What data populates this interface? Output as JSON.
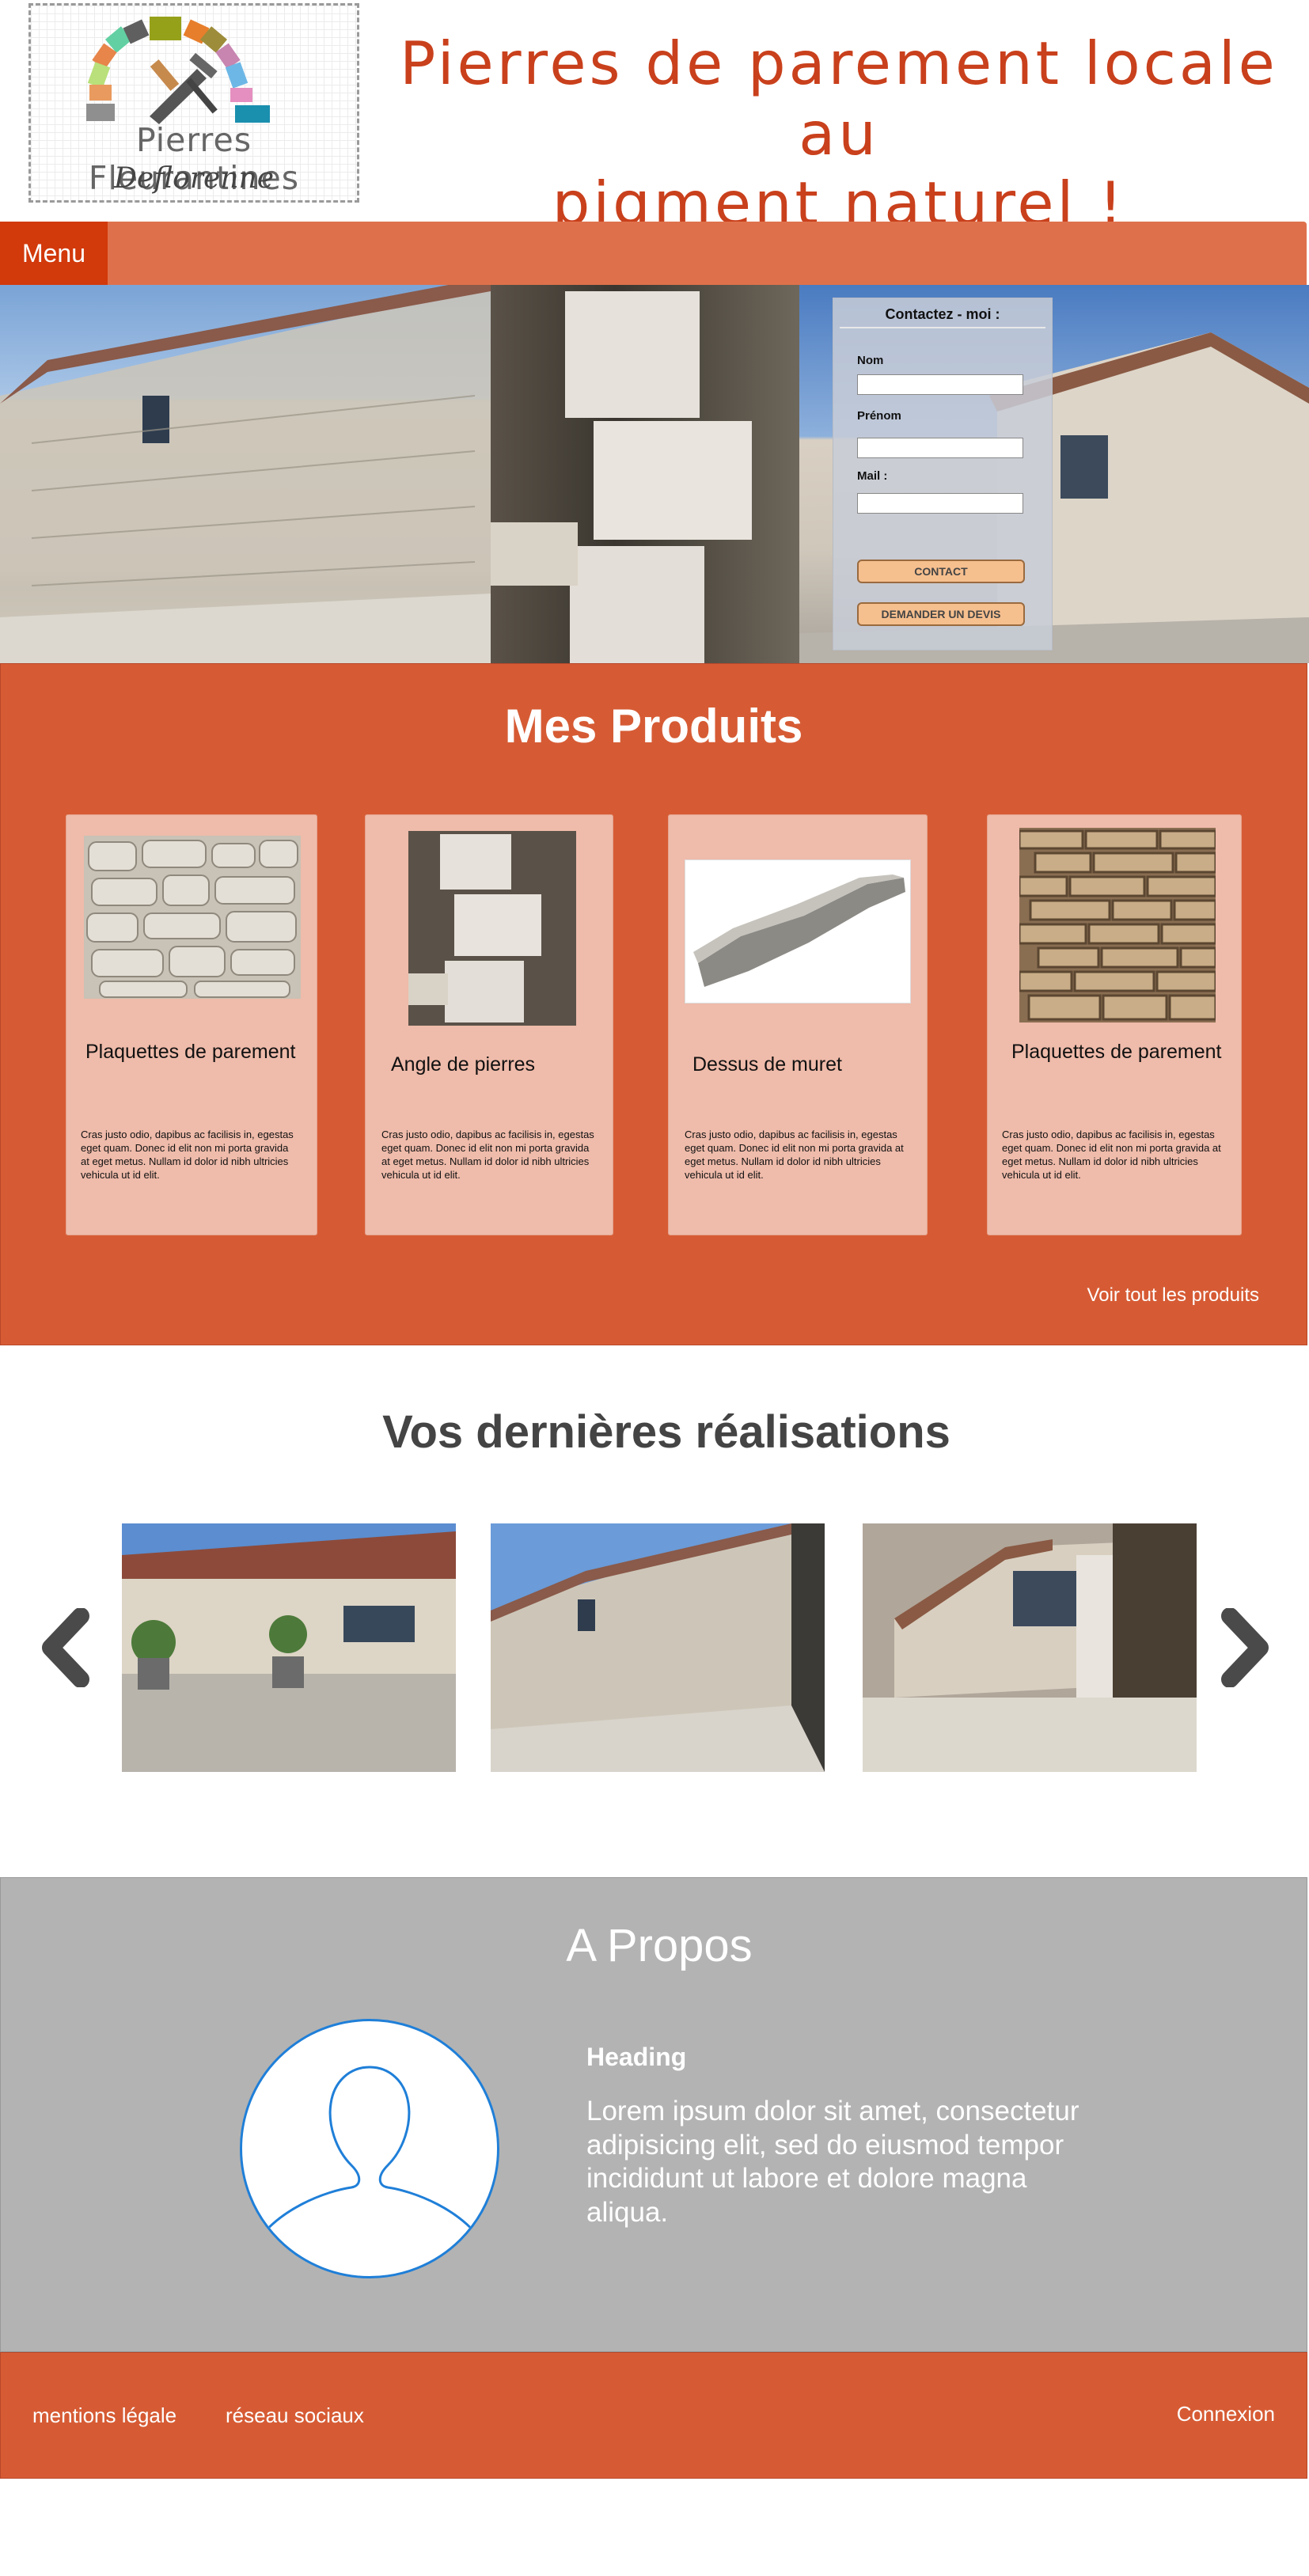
{
  "header": {
    "logo_brand": "Pierres Fleurantines",
    "logo_sub": "Deflorenne",
    "title_line1": "Pierres de parement locale au",
    "title_line2": "pigment naturel !"
  },
  "nav": {
    "menu_label": "Menu"
  },
  "contact_form": {
    "title": "Contactez - moi :",
    "name_label": "Nom",
    "firstname_label": "Prénom",
    "mail_label": "Mail :",
    "name_value": "",
    "firstname_value": "",
    "mail_value": "",
    "contact_button": "CONTACT",
    "quote_button": "DEMANDER UN DEVIS"
  },
  "products": {
    "title": "Mes Produits",
    "items": [
      {
        "name": "Plaquettes de parement",
        "desc": "Cras justo odio, dapibus ac facilisis in, egestas eget quam. Donec id elit non mi porta gravida at eget metus. Nullam id dolor id nibh ultricies vehicula ut id elit."
      },
      {
        "name": "Angle de pierres",
        "desc": "Cras justo odio, dapibus ac facilisis in, egestas eget quam. Donec id elit non mi porta gravida at eget metus. Nullam id dolor id nibh ultricies vehicula ut id elit."
      },
      {
        "name": "Dessus de muret",
        "desc": "Cras justo odio, dapibus ac facilisis in, egestas eget quam. Donec id elit non mi porta gravida at eget metus. Nullam id dolor id nibh ultricies vehicula ut id elit."
      },
      {
        "name": "Plaquettes de parement",
        "desc": "Cras justo odio, dapibus ac facilisis in, egestas eget quam. Donec id elit non mi porta gravida at eget metus. Nullam id dolor id nibh ultricies vehicula ut id elit."
      }
    ],
    "see_all": "Voir tout les produits"
  },
  "realisations": {
    "title": "Vos dernières réalisations"
  },
  "about": {
    "title": "A Propos",
    "heading": "Heading",
    "text": "Lorem ipsum dolor sit amet, consectetur adipisicing elit, sed do eiusmod tempor incididunt ut labore et dolore magna aliqua."
  },
  "footer": {
    "legal": "mentions légale",
    "social": "réseau sociaux",
    "login": "Connexion"
  },
  "colors": {
    "brand_orange": "#d65b34",
    "nav_orange": "#de714b",
    "menu_red": "#d2390b",
    "title_red": "#c9401c",
    "about_grey": "#b3b3b3",
    "button_peach": "#f6bf8e"
  },
  "icons": [
    "chevron-left-icon",
    "chevron-right-icon",
    "user-silhouette-icon",
    "trowel-hammer-icon"
  ]
}
